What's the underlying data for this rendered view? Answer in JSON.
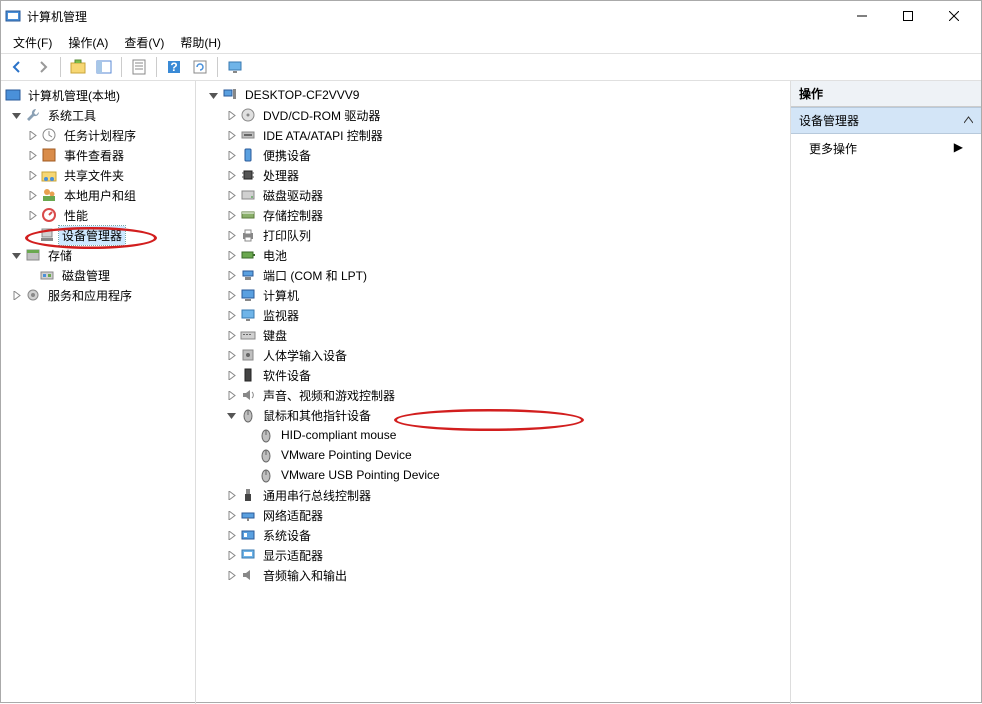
{
  "window": {
    "title": "计算机管理"
  },
  "menu": {
    "file": "文件(F)",
    "action": "操作(A)",
    "view": "查看(V)",
    "help": "帮助(H)"
  },
  "left": {
    "root": "计算机管理(本地)",
    "system_tools": "系统工具",
    "task_scheduler": "任务计划程序",
    "event_viewer": "事件查看器",
    "shared_folders": "共享文件夹",
    "local_users_groups": "本地用户和组",
    "performance": "性能",
    "device_manager": "设备管理器",
    "storage": "存储",
    "disk_management": "磁盘管理",
    "services_apps": "服务和应用程序"
  },
  "mid": {
    "root": "DESKTOP-CF2VVV9",
    "items": [
      "DVD/CD-ROM 驱动器",
      "IDE ATA/ATAPI 控制器",
      "便携设备",
      "处理器",
      "磁盘驱动器",
      "存储控制器",
      "打印队列",
      "电池",
      "端口 (COM 和 LPT)",
      "计算机",
      "监视器",
      "键盘",
      "人体学输入设备",
      "软件设备",
      "声音、视频和游戏控制器"
    ],
    "mice_cat": "鼠标和其他指针设备",
    "mice": [
      "HID-compliant mouse",
      "VMware Pointing Device",
      "VMware USB Pointing Device"
    ],
    "items2": [
      "通用串行总线控制器",
      "网络适配器",
      "系统设备",
      "显示适配器",
      "音频输入和输出"
    ]
  },
  "right": {
    "header": "操作",
    "section": "设备管理器",
    "more": "更多操作"
  }
}
